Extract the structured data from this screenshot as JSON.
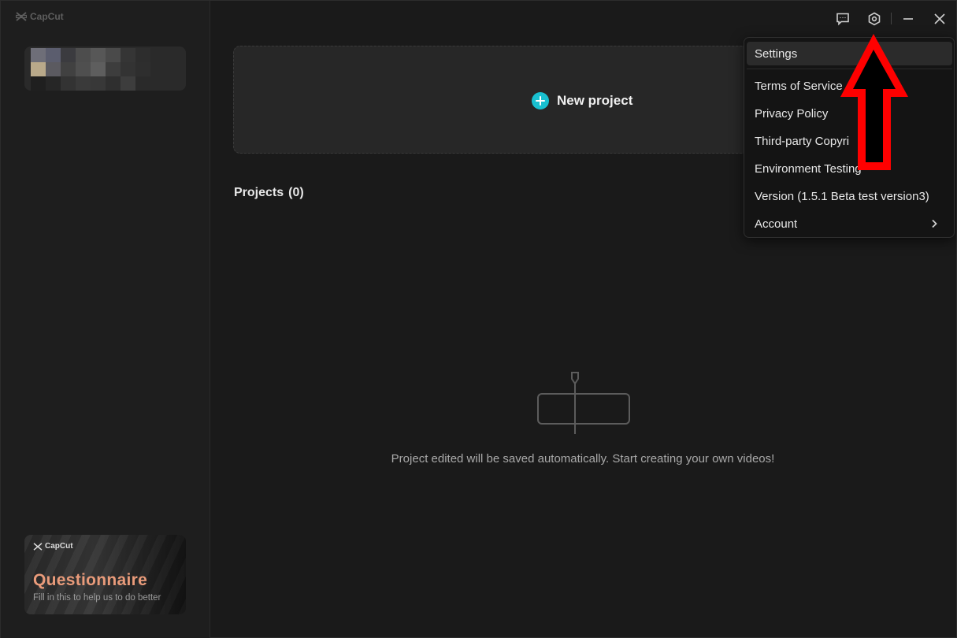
{
  "app": {
    "brand": "CapCut",
    "accent_color": "#19c0d0"
  },
  "titlebar": {
    "feedback_icon": "chat-bubble-icon",
    "settings_icon": "hexagon-gear-icon",
    "minimize_icon": "minimize-icon",
    "close_icon": "close-icon"
  },
  "sidebar": {
    "account_label": "",
    "questionnaire": {
      "brand": "CapCut",
      "title": "Questionnaire",
      "subtitle": "Fill in this to help us to do better"
    }
  },
  "main": {
    "new_project_label": "New project",
    "projects_label": "Projects",
    "projects_count": "(0)",
    "empty_message": "Project edited will be saved automatically. Start creating your own videos!"
  },
  "settings_menu": {
    "items": [
      {
        "label": "Settings"
      },
      {
        "label": "Terms of Service"
      },
      {
        "label": "Privacy Policy"
      },
      {
        "label": "Third-party Copyri"
      },
      {
        "label": "Environment Testing"
      },
      {
        "label": "Version (1.5.1 Beta test version3)"
      },
      {
        "label": "Account"
      }
    ],
    "highlight_color": "#ff0000"
  }
}
